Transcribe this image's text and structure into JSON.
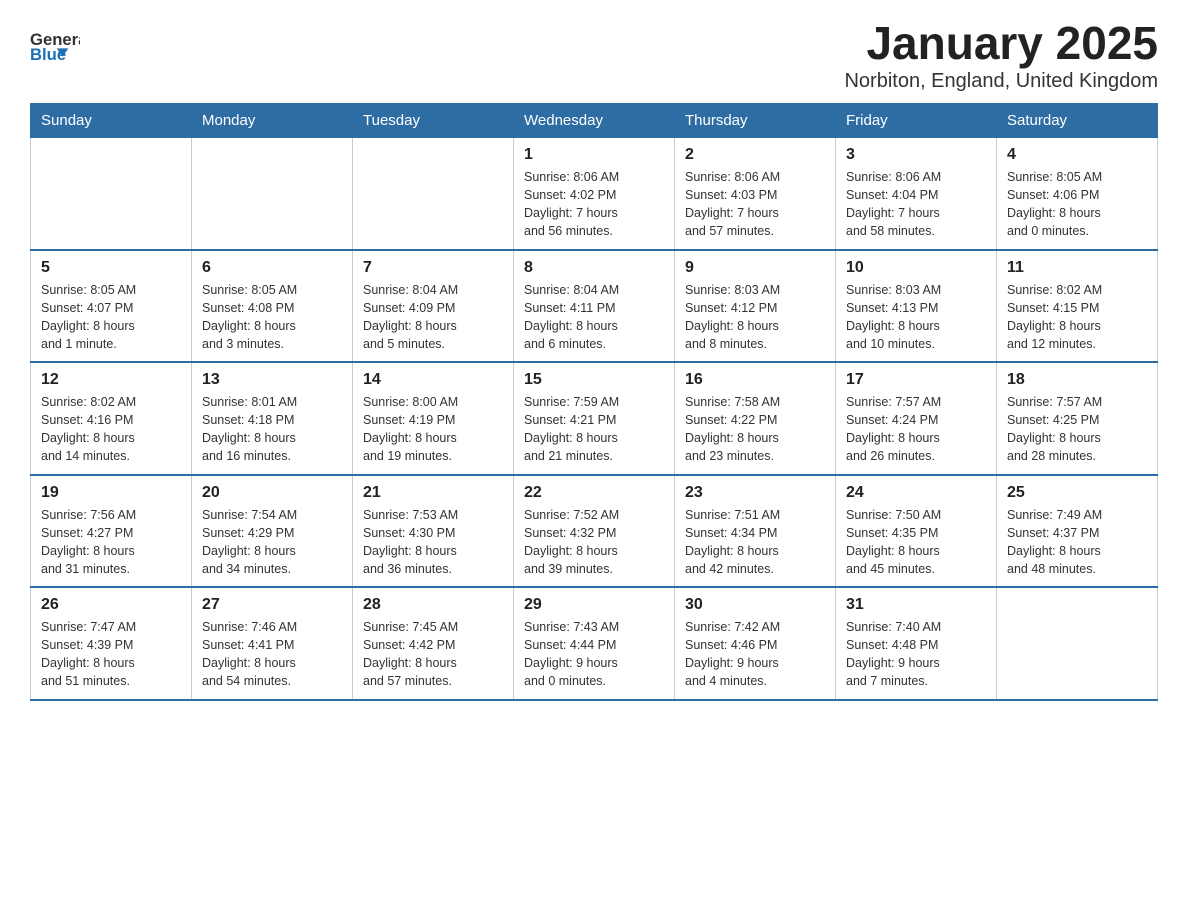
{
  "header": {
    "title": "January 2025",
    "location": "Norbiton, England, United Kingdom",
    "logo_general": "General",
    "logo_blue": "Blue"
  },
  "weekdays": [
    "Sunday",
    "Monday",
    "Tuesday",
    "Wednesday",
    "Thursday",
    "Friday",
    "Saturday"
  ],
  "weeks": [
    [
      {
        "day": "",
        "info": ""
      },
      {
        "day": "",
        "info": ""
      },
      {
        "day": "",
        "info": ""
      },
      {
        "day": "1",
        "info": "Sunrise: 8:06 AM\nSunset: 4:02 PM\nDaylight: 7 hours\nand 56 minutes."
      },
      {
        "day": "2",
        "info": "Sunrise: 8:06 AM\nSunset: 4:03 PM\nDaylight: 7 hours\nand 57 minutes."
      },
      {
        "day": "3",
        "info": "Sunrise: 8:06 AM\nSunset: 4:04 PM\nDaylight: 7 hours\nand 58 minutes."
      },
      {
        "day": "4",
        "info": "Sunrise: 8:05 AM\nSunset: 4:06 PM\nDaylight: 8 hours\nand 0 minutes."
      }
    ],
    [
      {
        "day": "5",
        "info": "Sunrise: 8:05 AM\nSunset: 4:07 PM\nDaylight: 8 hours\nand 1 minute."
      },
      {
        "day": "6",
        "info": "Sunrise: 8:05 AM\nSunset: 4:08 PM\nDaylight: 8 hours\nand 3 minutes."
      },
      {
        "day": "7",
        "info": "Sunrise: 8:04 AM\nSunset: 4:09 PM\nDaylight: 8 hours\nand 5 minutes."
      },
      {
        "day": "8",
        "info": "Sunrise: 8:04 AM\nSunset: 4:11 PM\nDaylight: 8 hours\nand 6 minutes."
      },
      {
        "day": "9",
        "info": "Sunrise: 8:03 AM\nSunset: 4:12 PM\nDaylight: 8 hours\nand 8 minutes."
      },
      {
        "day": "10",
        "info": "Sunrise: 8:03 AM\nSunset: 4:13 PM\nDaylight: 8 hours\nand 10 minutes."
      },
      {
        "day": "11",
        "info": "Sunrise: 8:02 AM\nSunset: 4:15 PM\nDaylight: 8 hours\nand 12 minutes."
      }
    ],
    [
      {
        "day": "12",
        "info": "Sunrise: 8:02 AM\nSunset: 4:16 PM\nDaylight: 8 hours\nand 14 minutes."
      },
      {
        "day": "13",
        "info": "Sunrise: 8:01 AM\nSunset: 4:18 PM\nDaylight: 8 hours\nand 16 minutes."
      },
      {
        "day": "14",
        "info": "Sunrise: 8:00 AM\nSunset: 4:19 PM\nDaylight: 8 hours\nand 19 minutes."
      },
      {
        "day": "15",
        "info": "Sunrise: 7:59 AM\nSunset: 4:21 PM\nDaylight: 8 hours\nand 21 minutes."
      },
      {
        "day": "16",
        "info": "Sunrise: 7:58 AM\nSunset: 4:22 PM\nDaylight: 8 hours\nand 23 minutes."
      },
      {
        "day": "17",
        "info": "Sunrise: 7:57 AM\nSunset: 4:24 PM\nDaylight: 8 hours\nand 26 minutes."
      },
      {
        "day": "18",
        "info": "Sunrise: 7:57 AM\nSunset: 4:25 PM\nDaylight: 8 hours\nand 28 minutes."
      }
    ],
    [
      {
        "day": "19",
        "info": "Sunrise: 7:56 AM\nSunset: 4:27 PM\nDaylight: 8 hours\nand 31 minutes."
      },
      {
        "day": "20",
        "info": "Sunrise: 7:54 AM\nSunset: 4:29 PM\nDaylight: 8 hours\nand 34 minutes."
      },
      {
        "day": "21",
        "info": "Sunrise: 7:53 AM\nSunset: 4:30 PM\nDaylight: 8 hours\nand 36 minutes."
      },
      {
        "day": "22",
        "info": "Sunrise: 7:52 AM\nSunset: 4:32 PM\nDaylight: 8 hours\nand 39 minutes."
      },
      {
        "day": "23",
        "info": "Sunrise: 7:51 AM\nSunset: 4:34 PM\nDaylight: 8 hours\nand 42 minutes."
      },
      {
        "day": "24",
        "info": "Sunrise: 7:50 AM\nSunset: 4:35 PM\nDaylight: 8 hours\nand 45 minutes."
      },
      {
        "day": "25",
        "info": "Sunrise: 7:49 AM\nSunset: 4:37 PM\nDaylight: 8 hours\nand 48 minutes."
      }
    ],
    [
      {
        "day": "26",
        "info": "Sunrise: 7:47 AM\nSunset: 4:39 PM\nDaylight: 8 hours\nand 51 minutes."
      },
      {
        "day": "27",
        "info": "Sunrise: 7:46 AM\nSunset: 4:41 PM\nDaylight: 8 hours\nand 54 minutes."
      },
      {
        "day": "28",
        "info": "Sunrise: 7:45 AM\nSunset: 4:42 PM\nDaylight: 8 hours\nand 57 minutes."
      },
      {
        "day": "29",
        "info": "Sunrise: 7:43 AM\nSunset: 4:44 PM\nDaylight: 9 hours\nand 0 minutes."
      },
      {
        "day": "30",
        "info": "Sunrise: 7:42 AM\nSunset: 4:46 PM\nDaylight: 9 hours\nand 4 minutes."
      },
      {
        "day": "31",
        "info": "Sunrise: 7:40 AM\nSunset: 4:48 PM\nDaylight: 9 hours\nand 7 minutes."
      },
      {
        "day": "",
        "info": ""
      }
    ]
  ]
}
